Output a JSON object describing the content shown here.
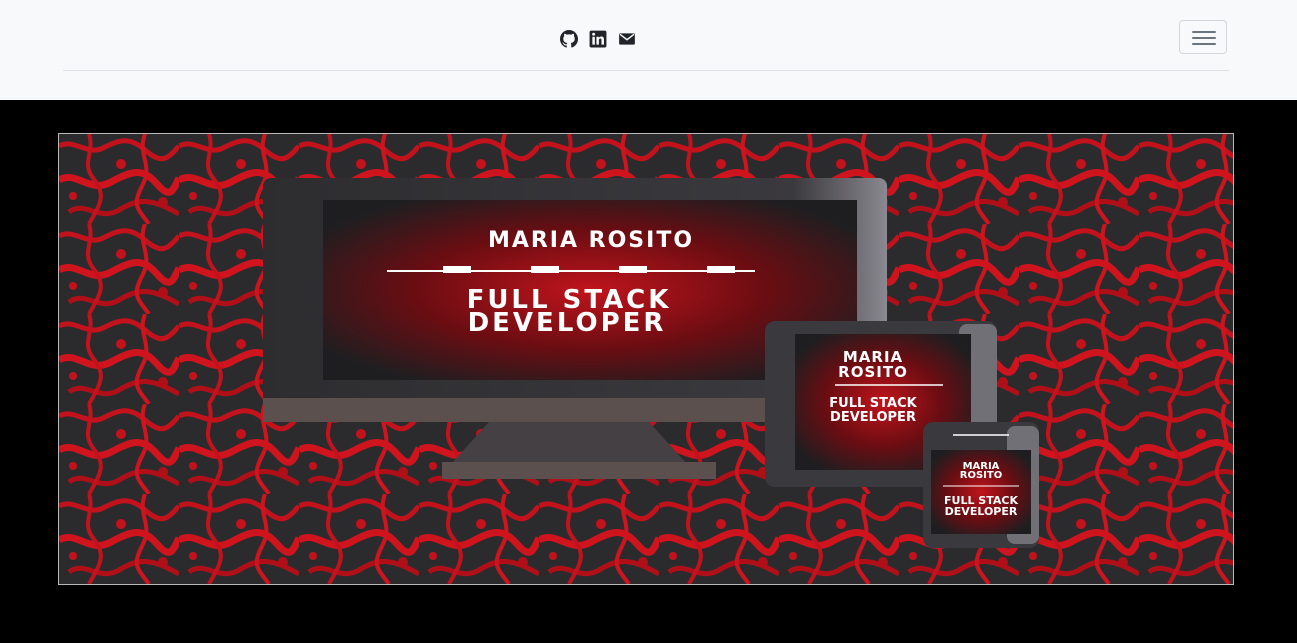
{
  "navbar": {
    "social": [
      {
        "icon": "github-icon"
      },
      {
        "icon": "linkedin-icon"
      },
      {
        "icon": "envelope-icon"
      }
    ],
    "toggler_icon": "hamburger-icon"
  },
  "hero": {
    "desktop": {
      "name": "MARIA ROSITO",
      "role_line1": "FULL STACK",
      "role_line2": "DEVELOPER"
    },
    "tablet": {
      "name_line1": "MARIA",
      "name_line2": "ROSITO",
      "role_line1": "FULL STACK",
      "role_line2": "DEVELOPER"
    },
    "phone": {
      "name_line1": "MARIA",
      "name_line2": "ROSITO",
      "role_line1": "FULL STACK",
      "role_line2": "DEVELOPER"
    },
    "colors": {
      "accent": "#d0141e",
      "background": "#2b2b2d",
      "text": "#ffffff"
    }
  }
}
